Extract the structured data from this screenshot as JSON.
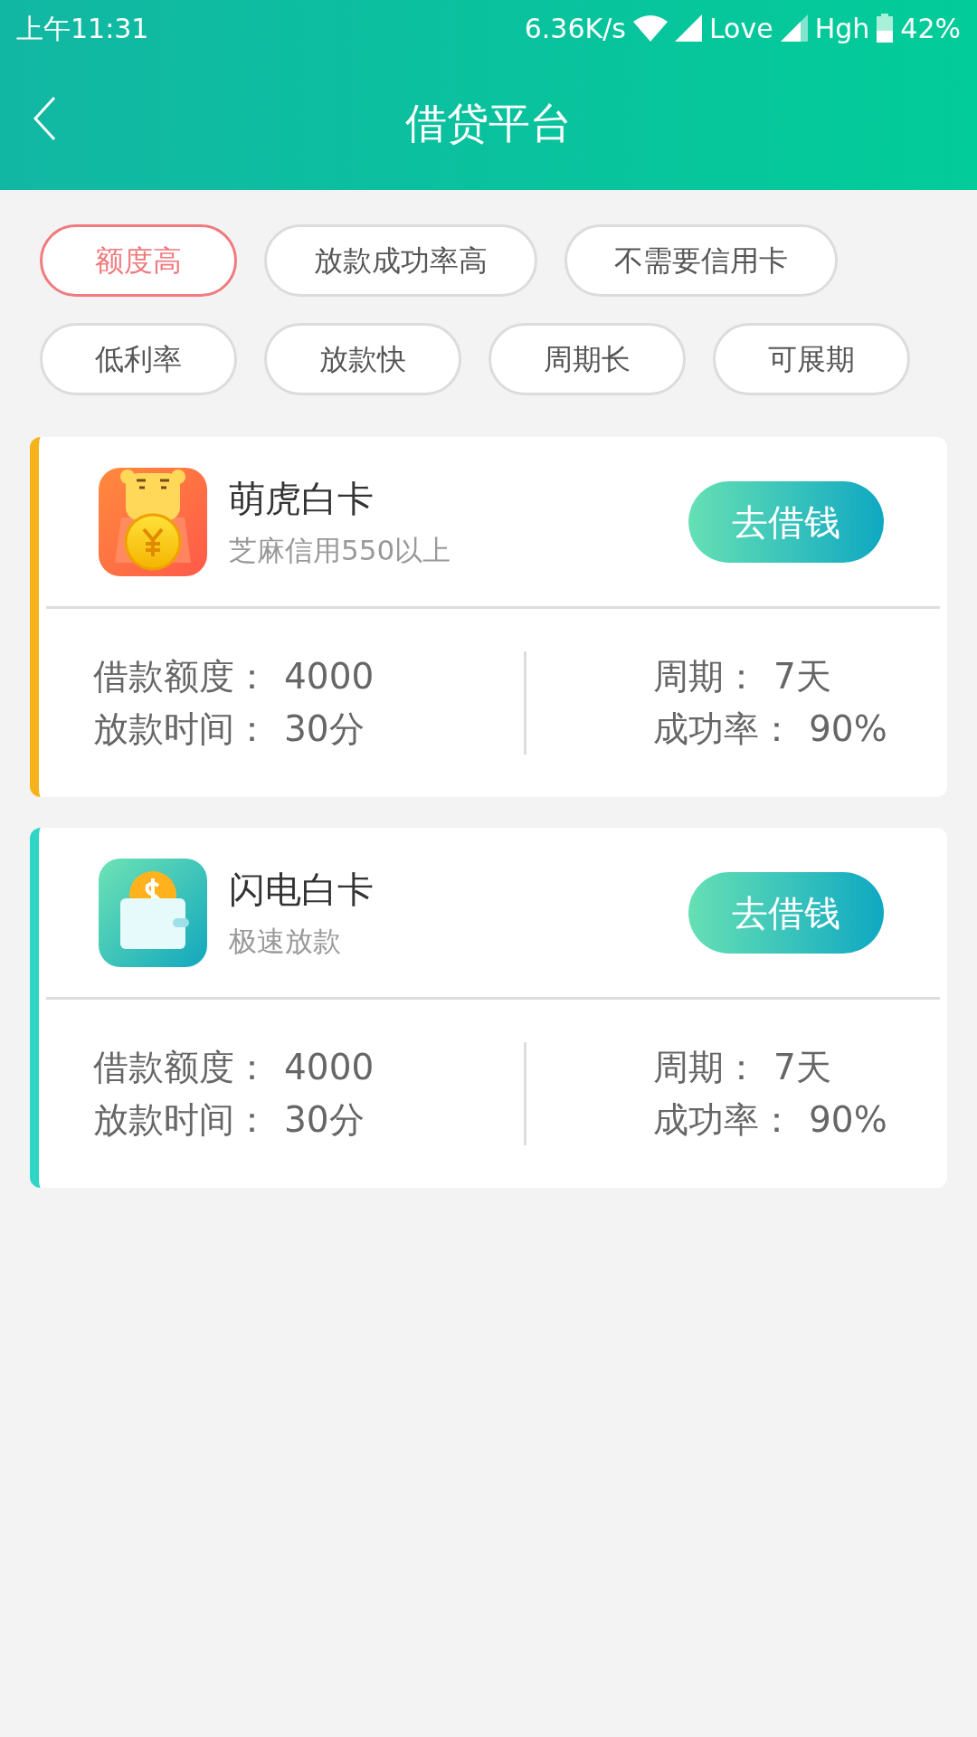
{
  "status_bar": {
    "time": "上午11:31",
    "speed": "6.36K/s",
    "carrier_1": "Love",
    "carrier_2": "Hgh",
    "battery": "42%"
  },
  "header": {
    "title": "借贷平台"
  },
  "filters": [
    {
      "label": "额度高",
      "selected": true
    },
    {
      "label": "放款成功率高",
      "selected": false
    },
    {
      "label": "不需要信用卡",
      "selected": false
    },
    {
      "label": "低利率",
      "selected": false
    },
    {
      "label": "放款快",
      "selected": false
    },
    {
      "label": "周期长",
      "selected": false
    },
    {
      "label": "可展期",
      "selected": false
    }
  ],
  "cards": [
    {
      "color": "#f5b21b",
      "name": "萌虎白卡",
      "subtitle": "芝麻信用550以上",
      "button": "去借钱",
      "left": [
        {
          "label": "借款额度：",
          "value": "4000"
        },
        {
          "label": "放款时间：",
          "value": "30分"
        }
      ],
      "right": [
        {
          "label": "周期：",
          "value": "7天"
        },
        {
          "label": "成功率：",
          "value": "90%"
        }
      ]
    },
    {
      "color": "#2fd6c6",
      "name": "闪电白卡",
      "subtitle": "极速放款",
      "button": "去借钱",
      "left": [
        {
          "label": "借款额度：",
          "value": "4000"
        },
        {
          "label": "放款时间：",
          "value": "30分"
        }
      ],
      "right": [
        {
          "label": "周期：",
          "value": "7天"
        },
        {
          "label": "成功率：",
          "value": "90%"
        }
      ]
    }
  ]
}
